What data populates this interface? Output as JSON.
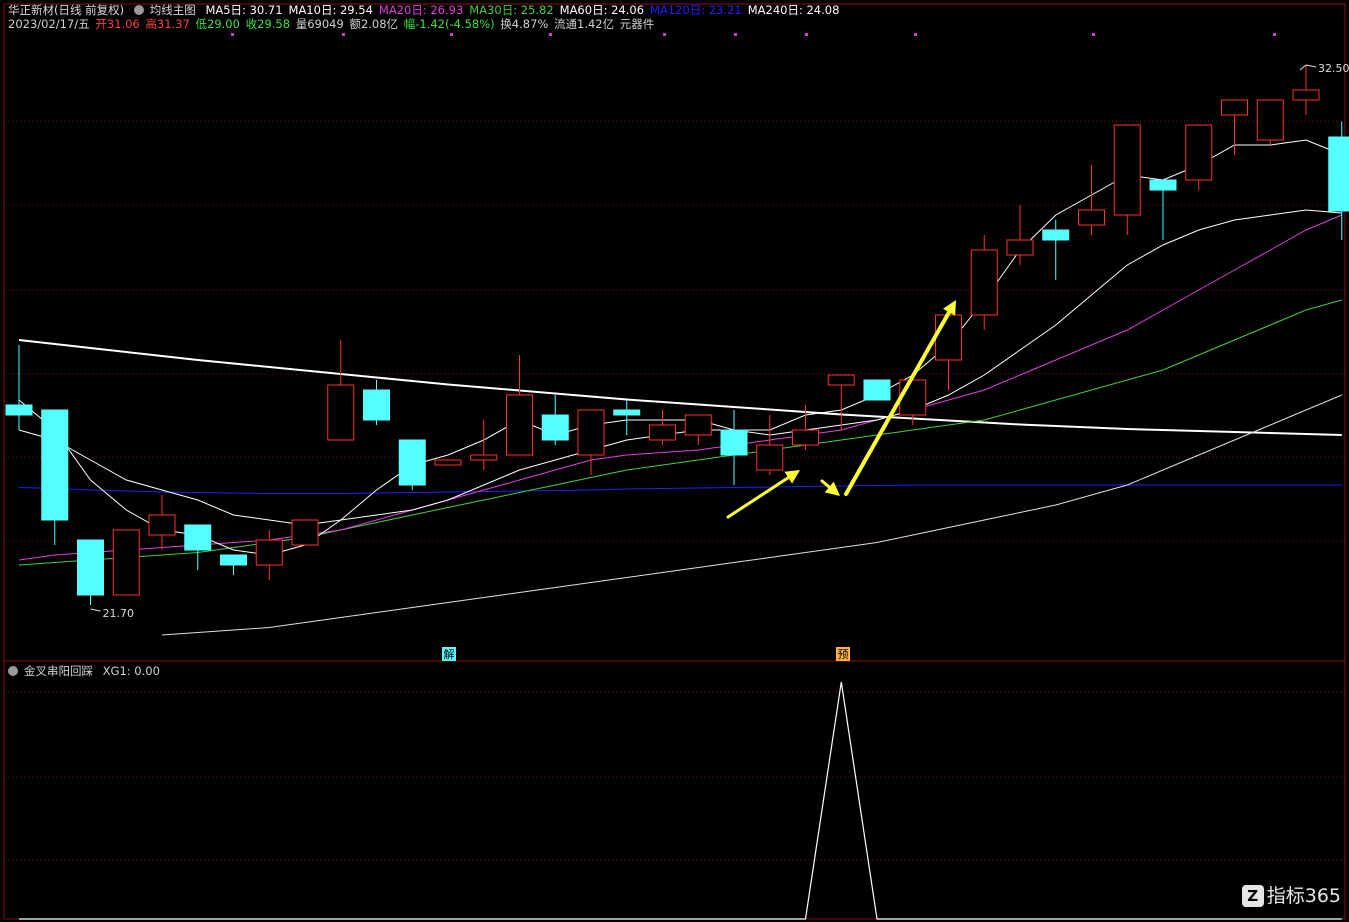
{
  "header": {
    "stock_name": "华正新材(日线 前复权)",
    "main_indicator": "均线主图",
    "ma": [
      {
        "label": "MA5日: 30.71",
        "color": "#ffffff"
      },
      {
        "label": "MA10日: 29.54",
        "color": "#ffffff"
      },
      {
        "label": "MA20日: 26.93",
        "color": "#e040e0"
      },
      {
        "label": "MA30日: 25.82",
        "color": "#40d040"
      },
      {
        "label": "MA60日: 24.06",
        "color": "#ffffff"
      },
      {
        "label": "MA120日: 23.21",
        "color": "#2020ff"
      },
      {
        "label": "MA240日: 24.08",
        "color": "#ffffff"
      }
    ],
    "quote": {
      "date": "2023/02/17/五",
      "open": "开31.06",
      "high": "高31.37",
      "low": "低29.00",
      "close": "收29.58",
      "volume": "量69049",
      "amount": "额2.08亿",
      "change": "幅-1.42(-4.58%)",
      "turnover": "换4.87%",
      "float": "流通1.42亿",
      "sector": "元器件"
    }
  },
  "indicator": {
    "name": "金叉串阳回踩",
    "value_label": "XG1: 0.00"
  },
  "markers": {
    "jie": "解",
    "yu": "预"
  },
  "watermark": {
    "text": "指标365",
    "icon": "Z"
  },
  "colors": {
    "up": "#ff3030",
    "down": "#54ffff",
    "ma5": "#ffffff",
    "ma10": "#ffffff",
    "ma20": "#e040e0",
    "ma30": "#40d040",
    "ma60": "#e0e0e0",
    "ma120": "#2020ff",
    "ma240": "#ffffff",
    "arrow": "#ffff33"
  },
  "chart_data": {
    "type": "candlestick",
    "price_range": [
      21.0,
      33.0
    ],
    "high_label": "32.50",
    "low_label": "21.70",
    "candles": [
      {
        "o": 25.7,
        "h": 26.9,
        "l": 25.2,
        "c": 25.5
      },
      {
        "o": 25.6,
        "h": 25.6,
        "l": 22.9,
        "c": 23.4
      },
      {
        "o": 23.0,
        "h": 23.0,
        "l": 21.7,
        "c": 21.9
      },
      {
        "o": 21.9,
        "h": 23.2,
        "l": 21.9,
        "c": 23.2
      },
      {
        "o": 23.1,
        "h": 23.9,
        "l": 22.8,
        "c": 23.5
      },
      {
        "o": 23.3,
        "h": 23.3,
        "l": 22.4,
        "c": 22.8
      },
      {
        "o": 22.7,
        "h": 22.7,
        "l": 22.3,
        "c": 22.5
      },
      {
        "o": 22.5,
        "h": 23.2,
        "l": 22.2,
        "c": 23.0
      },
      {
        "o": 22.9,
        "h": 23.4,
        "l": 22.9,
        "c": 23.4
      },
      {
        "o": 25.0,
        "h": 27.0,
        "l": 25.0,
        "c": 26.1
      },
      {
        "o": 26.0,
        "h": 26.2,
        "l": 25.3,
        "c": 25.4
      },
      {
        "o": 25.0,
        "h": 25.0,
        "l": 24.0,
        "c": 24.1
      },
      {
        "o": 24.5,
        "h": 24.5,
        "l": 24.5,
        "c": 24.6
      },
      {
        "o": 24.6,
        "h": 25.4,
        "l": 24.4,
        "c": 24.7
      },
      {
        "o": 24.7,
        "h": 26.7,
        "l": 24.7,
        "c": 25.9
      },
      {
        "o": 25.5,
        "h": 25.9,
        "l": 24.9,
        "c": 25.0
      },
      {
        "o": 24.7,
        "h": 25.6,
        "l": 24.3,
        "c": 25.6
      },
      {
        "o": 25.6,
        "h": 25.8,
        "l": 25.1,
        "c": 25.5
      },
      {
        "o": 25.0,
        "h": 25.6,
        "l": 24.9,
        "c": 25.3
      },
      {
        "o": 25.1,
        "h": 25.5,
        "l": 24.9,
        "c": 25.5
      },
      {
        "o": 25.2,
        "h": 25.6,
        "l": 24.1,
        "c": 24.7
      },
      {
        "o": 24.4,
        "h": 25.5,
        "l": 24.3,
        "c": 24.9
      },
      {
        "o": 24.9,
        "h": 25.7,
        "l": 24.8,
        "c": 25.2
      },
      {
        "o": 26.1,
        "h": 26.1,
        "l": 25.2,
        "c": 26.3
      },
      {
        "o": 26.2,
        "h": 26.2,
        "l": 25.9,
        "c": 25.8
      },
      {
        "o": 25.5,
        "h": 25.6,
        "l": 25.3,
        "c": 26.2
      },
      {
        "o": 26.6,
        "h": 26.6,
        "l": 26.0,
        "c": 27.5
      },
      {
        "o": 27.5,
        "h": 29.1,
        "l": 27.2,
        "c": 28.8
      },
      {
        "o": 28.7,
        "h": 29.7,
        "l": 28.5,
        "c": 29.0
      },
      {
        "o": 29.2,
        "h": 29.4,
        "l": 28.2,
        "c": 29.0
      },
      {
        "o": 29.3,
        "h": 30.5,
        "l": 29.1,
        "c": 29.6
      },
      {
        "o": 29.5,
        "h": 30.9,
        "l": 29.1,
        "c": 31.3
      },
      {
        "o": 30.2,
        "h": 30.2,
        "l": 29.0,
        "c": 30.0
      },
      {
        "o": 30.2,
        "h": 30.2,
        "l": 30.0,
        "c": 31.3
      },
      {
        "o": 31.5,
        "h": 31.5,
        "l": 30.7,
        "c": 31.8
      },
      {
        "o": 31.0,
        "h": 31.0,
        "l": 30.9,
        "c": 31.8
      },
      {
        "o": 31.8,
        "h": 32.5,
        "l": 31.5,
        "c": 32.0
      },
      {
        "o": 31.06,
        "h": 31.37,
        "l": 29.0,
        "c": 29.58
      }
    ],
    "ma5": [
      25.8,
      25.2,
      24.2,
      23.6,
      23.2,
      23.1,
      22.8,
      22.7,
      22.9,
      23.4,
      24.0,
      24.5,
      24.7,
      25.0,
      25.4,
      25.1,
      25.3,
      25.4,
      25.4,
      25.4,
      25.2,
      25.2,
      25.5,
      25.6,
      25.9,
      26.3,
      26.9,
      27.8,
      28.8,
      29.5,
      29.9,
      30.3,
      30.2,
      30.5,
      30.9,
      30.9,
      31.0,
      30.71
    ],
    "ma10": [
      25.2,
      25.0,
      24.6,
      24.2,
      24.0,
      23.8,
      23.5,
      23.4,
      23.3,
      23.4,
      23.5,
      23.6,
      23.8,
      24.1,
      24.4,
      24.6,
      24.8,
      25.0,
      25.1,
      25.2,
      25.2,
      25.1,
      25.2,
      25.3,
      25.4,
      25.6,
      25.9,
      26.3,
      26.8,
      27.3,
      27.9,
      28.5,
      28.9,
      29.2,
      29.4,
      29.5,
      29.6,
      29.54
    ],
    "ma20": [
      22.6,
      22.7,
      22.75,
      22.8,
      22.85,
      22.9,
      22.95,
      23.0,
      23.1,
      23.2,
      23.4,
      23.6,
      23.8,
      24.0,
      24.2,
      24.4,
      24.6,
      24.7,
      24.75,
      24.8,
      24.9,
      25.0,
      25.1,
      25.2,
      25.4,
      25.6,
      25.8,
      26.0,
      26.3,
      26.6,
      26.9,
      27.2,
      27.6,
      28.0,
      28.4,
      28.8,
      29.2,
      29.5
    ],
    "ma30": [
      22.5,
      22.55,
      22.6,
      22.65,
      22.7,
      22.75,
      22.85,
      22.95,
      23.05,
      23.2,
      23.35,
      23.5,
      23.65,
      23.8,
      23.95,
      24.1,
      24.25,
      24.4,
      24.5,
      24.6,
      24.7,
      24.8,
      24.9,
      25.0,
      25.1,
      25.2,
      25.3,
      25.4,
      25.6,
      25.8,
      26.0,
      26.2,
      26.4,
      26.7,
      27.0,
      27.3,
      27.6,
      27.8
    ],
    "ma60": [
      null,
      null,
      null,
      null,
      21.1,
      21.15,
      21.2,
      21.25,
      21.35,
      21.45,
      21.55,
      21.65,
      21.75,
      21.85,
      21.95,
      22.05,
      22.15,
      22.25,
      22.35,
      22.45,
      22.55,
      22.65,
      22.75,
      22.85,
      22.95,
      23.1,
      23.25,
      23.4,
      23.55,
      23.7,
      23.9,
      24.1,
      24.4,
      24.7,
      25.0,
      25.3,
      25.6,
      25.9
    ],
    "ma120": [
      24.05,
      24.03,
      24.0,
      23.98,
      23.96,
      23.95,
      23.94,
      23.93,
      23.93,
      23.93,
      23.94,
      23.95,
      23.96,
      23.97,
      23.98,
      23.99,
      24.0,
      24.02,
      24.03,
      24.04,
      24.05,
      24.06,
      24.07,
      24.08,
      24.09,
      24.1,
      24.1,
      24.1,
      24.1,
      24.1,
      24.1,
      24.1,
      24.1,
      24.1,
      24.1,
      24.1,
      24.1,
      24.1
    ],
    "ma240": [
      27.0,
      26.92,
      26.84,
      26.76,
      26.68,
      26.6,
      26.53,
      26.46,
      26.39,
      26.32,
      26.25,
      26.18,
      26.11,
      26.05,
      25.99,
      25.93,
      25.87,
      25.81,
      25.76,
      25.71,
      25.66,
      25.61,
      25.56,
      25.51,
      25.47,
      25.43,
      25.39,
      25.35,
      25.31,
      25.28,
      25.25,
      25.22,
      25.2,
      25.18,
      25.16,
      25.14,
      25.12,
      25.1
    ],
    "signal_xg1": [
      0,
      0,
      0,
      0,
      0,
      0,
      0,
      0,
      0,
      0,
      0,
      0,
      0,
      0,
      0,
      0,
      0,
      0,
      0,
      0,
      0,
      0,
      0,
      1,
      0,
      0,
      0,
      0,
      0,
      0,
      0,
      0,
      0,
      0,
      0,
      0,
      0,
      0
    ]
  }
}
